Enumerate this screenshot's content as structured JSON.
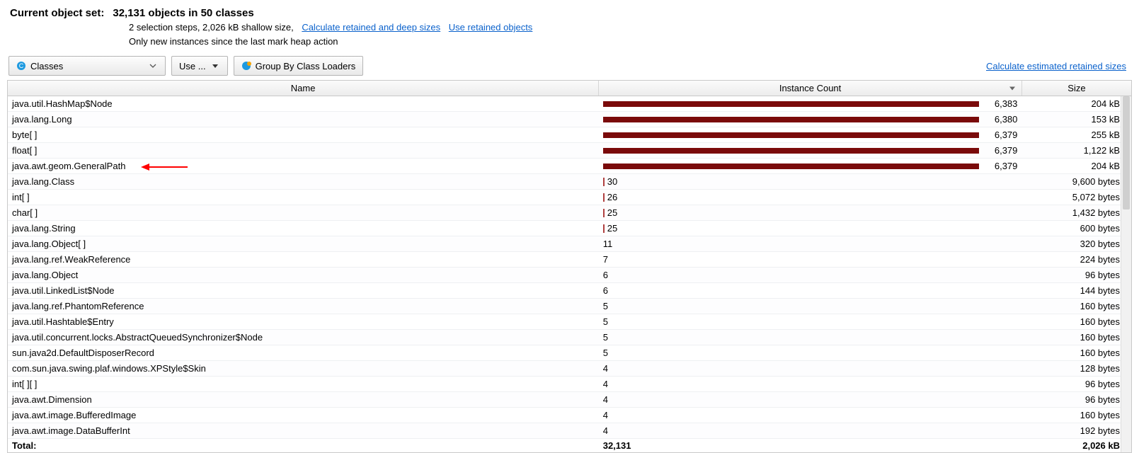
{
  "header": {
    "label": "Current object set:",
    "value": "32,131 objects in 50 classes"
  },
  "sub1": {
    "text": "2 selection steps, 2,026 kB shallow size,",
    "link1": "Calculate retained and deep sizes",
    "link2": "Use retained objects"
  },
  "sub2": {
    "text": "Only new instances since the last mark heap action"
  },
  "toolbar": {
    "classes_label": "Classes",
    "use_label": "Use ...",
    "group_label": "Group By Class Loaders"
  },
  "right_link": "Calculate estimated retained sizes",
  "columns": {
    "name": "Name",
    "count": "Instance Count",
    "size": "Size"
  },
  "max_count": 6383,
  "rows": [
    {
      "name": "java.util.HashMap$Node",
      "count": 6383,
      "count_str": "6,383",
      "size": "204 kB",
      "big": true
    },
    {
      "name": "java.lang.Long",
      "count": 6380,
      "count_str": "6,380",
      "size": "153 kB",
      "big": true
    },
    {
      "name": "byte[ ]",
      "count": 6379,
      "count_str": "6,379",
      "size": "255 kB",
      "big": true
    },
    {
      "name": "float[ ]",
      "count": 6379,
      "count_str": "6,379",
      "size": "1,122 kB",
      "big": true
    },
    {
      "name": "java.awt.geom.GeneralPath",
      "count": 6379,
      "count_str": "6,379",
      "size": "204 kB",
      "big": true,
      "arrow": true
    },
    {
      "name": "java.lang.Class",
      "count": 30,
      "count_str": "30",
      "size": "9,600 bytes",
      "tick": true
    },
    {
      "name": "int[ ]",
      "count": 26,
      "count_str": "26",
      "size": "5,072 bytes",
      "tick": true
    },
    {
      "name": "char[ ]",
      "count": 25,
      "count_str": "25",
      "size": "1,432 bytes",
      "tick": true
    },
    {
      "name": "java.lang.String",
      "count": 25,
      "count_str": "25",
      "size": "600 bytes",
      "tick": true
    },
    {
      "name": "java.lang.Object[ ]",
      "count": 11,
      "count_str": "11",
      "size": "320 bytes"
    },
    {
      "name": "java.lang.ref.WeakReference",
      "count": 7,
      "count_str": "7",
      "size": "224 bytes"
    },
    {
      "name": "java.lang.Object",
      "count": 6,
      "count_str": "6",
      "size": "96 bytes"
    },
    {
      "name": "java.util.LinkedList$Node",
      "count": 6,
      "count_str": "6",
      "size": "144 bytes"
    },
    {
      "name": "java.lang.ref.PhantomReference",
      "count": 5,
      "count_str": "5",
      "size": "160 bytes"
    },
    {
      "name": "java.util.Hashtable$Entry",
      "count": 5,
      "count_str": "5",
      "size": "160 bytes"
    },
    {
      "name": "java.util.concurrent.locks.AbstractQueuedSynchronizer$Node",
      "count": 5,
      "count_str": "5",
      "size": "160 bytes"
    },
    {
      "name": "sun.java2d.DefaultDisposerRecord",
      "count": 5,
      "count_str": "5",
      "size": "160 bytes"
    },
    {
      "name": "com.sun.java.swing.plaf.windows.XPStyle$Skin",
      "count": 4,
      "count_str": "4",
      "size": "128 bytes"
    },
    {
      "name": "int[ ][ ]",
      "count": 4,
      "count_str": "4",
      "size": "96 bytes"
    },
    {
      "name": "java.awt.Dimension",
      "count": 4,
      "count_str": "4",
      "size": "96 bytes"
    },
    {
      "name": "java.awt.image.BufferedImage",
      "count": 4,
      "count_str": "4",
      "size": "160 bytes"
    },
    {
      "name": "java.awt.image.DataBufferInt",
      "count": 4,
      "count_str": "4",
      "size": "192 bytes"
    }
  ],
  "totals": {
    "label": "Total:",
    "count": "32,131",
    "size": "2,026 kB"
  }
}
